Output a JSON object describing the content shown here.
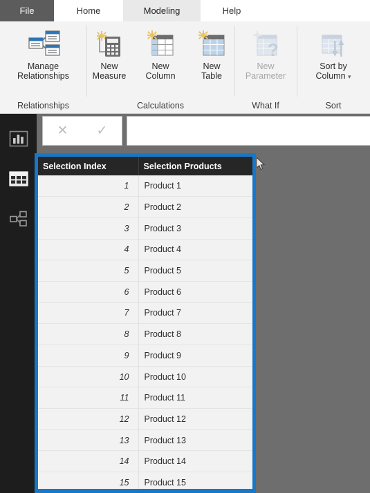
{
  "window": {
    "accent_blue": "#1878c8",
    "tab_file_bg": "#5c5c5c",
    "header_bg": "#262626",
    "canvas_bg": "#6e6e6e"
  },
  "tabs": [
    {
      "label": "File",
      "active": false
    },
    {
      "label": "Home",
      "active": false
    },
    {
      "label": "Modeling",
      "active": true
    },
    {
      "label": "Help",
      "active": false
    }
  ],
  "ribbon": {
    "groups": [
      {
        "label": "Relationships",
        "buttons": [
          {
            "label_line1": "Manage",
            "label_line2": "Relationships",
            "icon": "manage-relationships-icon",
            "disabled": false,
            "has_caret": false
          }
        ]
      },
      {
        "label": "Calculations",
        "buttons": [
          {
            "label_line1": "New",
            "label_line2": "Measure",
            "icon": "new-measure-icon",
            "disabled": false,
            "has_caret": false
          },
          {
            "label_line1": "New",
            "label_line2": "Column",
            "icon": "new-column-icon",
            "disabled": false,
            "has_caret": false
          },
          {
            "label_line1": "New",
            "label_line2": "Table",
            "icon": "new-table-icon",
            "disabled": false,
            "has_caret": false
          }
        ]
      },
      {
        "label": "What If",
        "buttons": [
          {
            "label_line1": "New",
            "label_line2": "Parameter",
            "icon": "new-parameter-icon",
            "disabled": true,
            "has_caret": false
          }
        ]
      },
      {
        "label": "Sort",
        "buttons": [
          {
            "label_line1": "Sort by",
            "label_line2": "Column",
            "icon": "sort-by-column-icon",
            "disabled": false,
            "has_caret": true,
            "caret": "▾"
          }
        ]
      }
    ]
  },
  "left_nav": {
    "items": [
      {
        "name": "report-view",
        "selected": false
      },
      {
        "name": "data-view",
        "selected": true
      },
      {
        "name": "model-view",
        "selected": false
      }
    ]
  },
  "formula_bar": {
    "cancel_glyph": "✕",
    "confirm_glyph": "✓",
    "value": "",
    "placeholder": ""
  },
  "grid": {
    "columns": [
      {
        "key": "index",
        "label": "Selection Index",
        "align": "right"
      },
      {
        "key": "product",
        "label": "Selection Products",
        "align": "left"
      }
    ],
    "rows": [
      {
        "index": "1",
        "product": "Product 1"
      },
      {
        "index": "2",
        "product": "Product 2"
      },
      {
        "index": "3",
        "product": "Product 3"
      },
      {
        "index": "4",
        "product": "Product 4"
      },
      {
        "index": "5",
        "product": "Product 5"
      },
      {
        "index": "6",
        "product": "Product 6"
      },
      {
        "index": "7",
        "product": "Product 7"
      },
      {
        "index": "8",
        "product": "Product 8"
      },
      {
        "index": "9",
        "product": "Product 9"
      },
      {
        "index": "10",
        "product": "Product 10"
      },
      {
        "index": "11",
        "product": "Product 11"
      },
      {
        "index": "12",
        "product": "Product 12"
      },
      {
        "index": "13",
        "product": "Product 13"
      },
      {
        "index": "14",
        "product": "Product 14"
      },
      {
        "index": "15",
        "product": "Product 15"
      }
    ]
  }
}
